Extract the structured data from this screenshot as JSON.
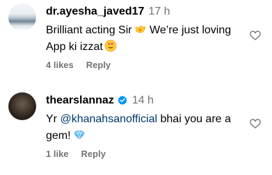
{
  "comments": [
    {
      "username": "dr.ayesha_javed17",
      "time": "17 h",
      "text_before": "Brilliant acting Sir",
      "text_middle": " We’re just loving App ki izzat",
      "emoji_1": "yellow-heart-hands-icon",
      "emoji_2": "heart-eyes-icon",
      "likes": "4 likes",
      "reply": "Reply"
    },
    {
      "username": "thearslannaz",
      "verified": true,
      "time": "14 h",
      "text_before": "Yr ",
      "mention": "@khanahsanofficial",
      "text_after": " bhai you are a gem!",
      "emoji_1": "gem-icon",
      "likes": "1 like",
      "reply": "Reply"
    }
  ],
  "colors": {
    "text": "#000000",
    "secondary": "#737373",
    "mention": "#00376b",
    "verified": "#0095f6"
  }
}
